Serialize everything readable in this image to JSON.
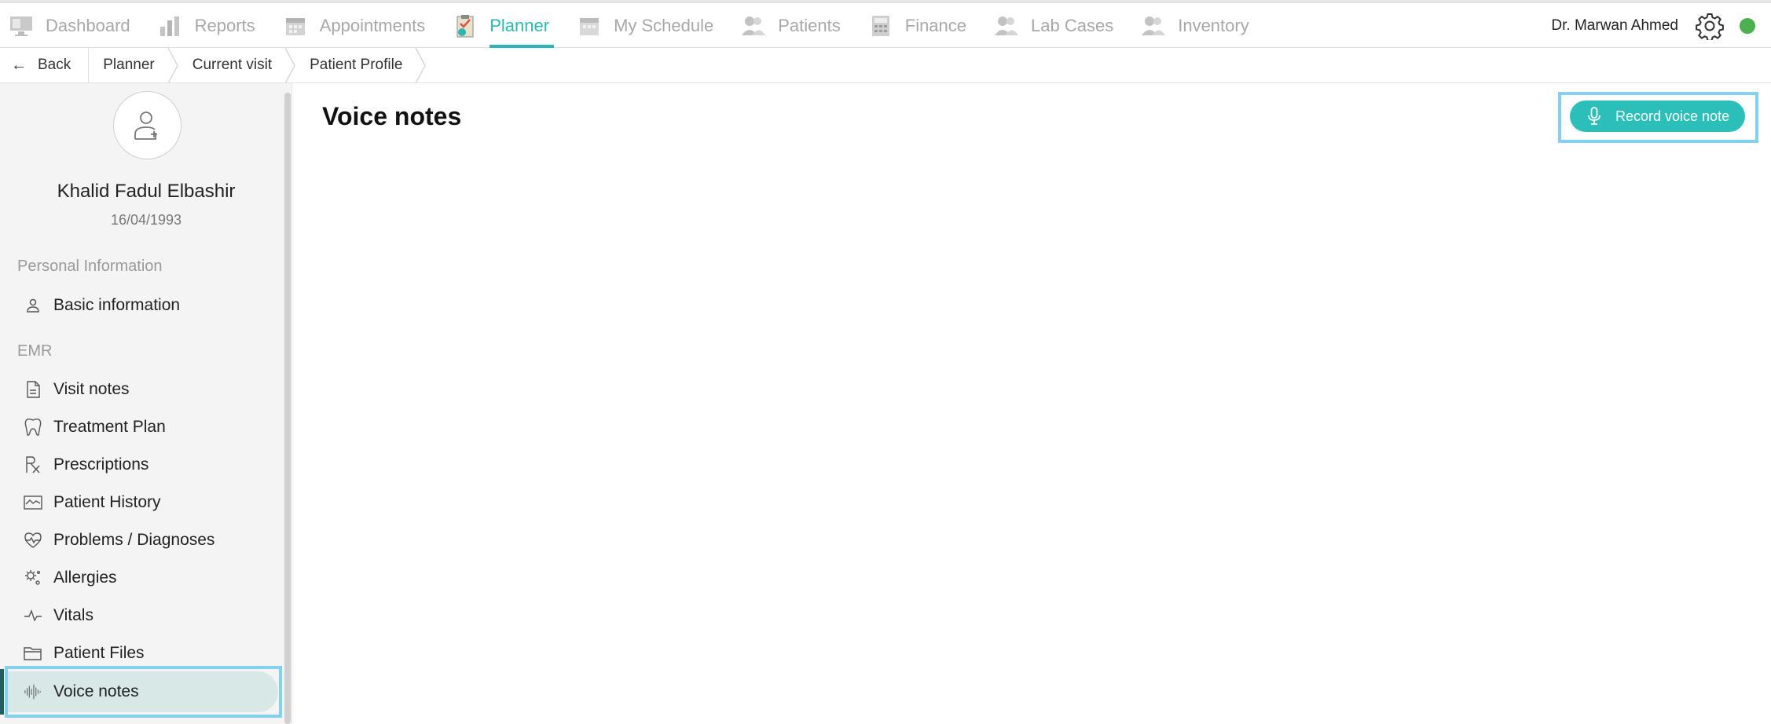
{
  "nav": {
    "items": [
      {
        "label": "Dashboard",
        "icon": "dashboard-monitor-icon"
      },
      {
        "label": "Reports",
        "icon": "bar-chart-icon"
      },
      {
        "label": "Appointments",
        "icon": "calendar-icon"
      },
      {
        "label": "Planner",
        "icon": "planner-clipboard-icon",
        "active": true
      },
      {
        "label": "My Schedule",
        "icon": "calendar-icon"
      },
      {
        "label": "Patients",
        "icon": "users-icon"
      },
      {
        "label": "Finance",
        "icon": "calculator-icon"
      },
      {
        "label": "Lab Cases",
        "icon": "users-icon"
      },
      {
        "label": "Inventory",
        "icon": "users-icon"
      }
    ],
    "user_name": "Dr. Marwan Ahmed"
  },
  "breadcrumb": {
    "back_label": "Back",
    "items": [
      "Planner",
      "Current visit",
      "Patient Profile"
    ]
  },
  "patient": {
    "name": "Khalid Fadul Elbashir",
    "dob": "16/04/1993"
  },
  "sidebar": {
    "section_personal": "Personal Information",
    "section_emr": "EMR",
    "basic_info": "Basic information",
    "items": [
      {
        "label": "Visit notes",
        "icon": "document-icon"
      },
      {
        "label": "Treatment Plan",
        "icon": "tooth-icon"
      },
      {
        "label": "Prescriptions",
        "icon": "prescription-icon"
      },
      {
        "label": "Patient History",
        "icon": "history-chart-icon"
      },
      {
        "label": "Problems / Diagnoses",
        "icon": "heart-pulse-icon"
      },
      {
        "label": "Allergies",
        "icon": "allergy-icon"
      },
      {
        "label": "Vitals",
        "icon": "pulse-icon"
      },
      {
        "label": "Patient Files",
        "icon": "folder-icon"
      },
      {
        "label": "Voice notes",
        "icon": "waveform-icon",
        "active": true
      }
    ]
  },
  "main": {
    "title": "Voice notes",
    "record_button": "Record voice note"
  },
  "colors": {
    "accent": "#2bb8b3",
    "status_online": "#4caf50",
    "highlight": "#83d0f0"
  }
}
